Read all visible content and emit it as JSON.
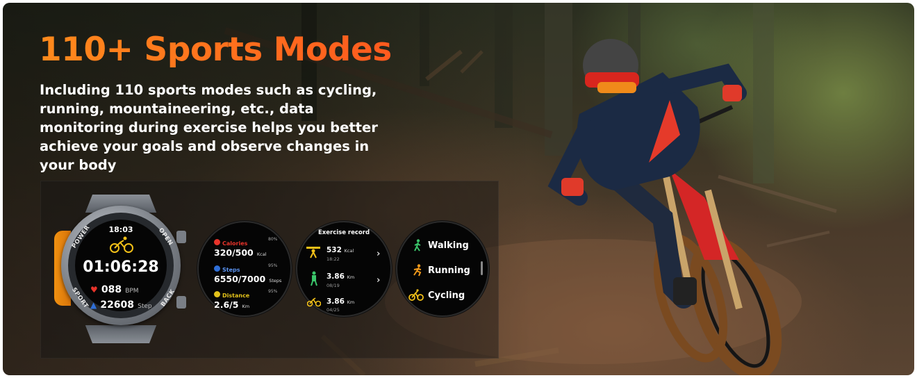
{
  "colors": {
    "accent_start": "#ff8a1c",
    "accent_end": "#ff5a1e",
    "calories": "#e8332a",
    "steps": "#2f6fd8",
    "distance": "#e3c21a",
    "walking": "#3ac46a",
    "running": "#f39a1a",
    "cycling": "#f2c018"
  },
  "headline": "110+ Sports Modes",
  "description": "Including 110 sports modes such as cycling, running, mountaineering, etc., data monitoring during exercise helps you better achieve your goals and observe changes in your body",
  "watch": {
    "time": "18:03",
    "workout_icon": "cycling-icon",
    "elapsed": "01:06:28",
    "heart_rate": "088",
    "heart_unit": "BPM",
    "steps": "22608",
    "steps_unit": "Step",
    "bezel_labels": {
      "top_left": "POWER",
      "top_right": "OPEN",
      "bottom_left": "SPORT",
      "bottom_right": "BACK"
    }
  },
  "stats_screen": {
    "items": [
      {
        "label": "Calories",
        "percent": "80%",
        "value": "320/500",
        "unit": "Kcal",
        "icon": "flame-icon"
      },
      {
        "label": "Steps",
        "percent": "95%",
        "value": "6550/7000",
        "unit": "Steps",
        "icon": "steps-icon"
      },
      {
        "label": "Distance",
        "percent": "95%",
        "value": "2.6/5",
        "unit": "Km",
        "icon": "location-pin-icon"
      }
    ]
  },
  "exercise_screen": {
    "title": "Exercise record",
    "records": [
      {
        "value": "532",
        "unit": "Kcal",
        "date": "18:22",
        "icon": "weightlifting-icon"
      },
      {
        "value": "3.86",
        "unit": "Km",
        "date": "08/19",
        "icon": "hiking-icon"
      },
      {
        "value": "3.86",
        "unit": "Km",
        "date": "04/25",
        "icon": "cycling-icon"
      }
    ]
  },
  "modes_screen": {
    "modes": [
      {
        "label": "Walking",
        "icon": "walking-icon"
      },
      {
        "label": "Running",
        "icon": "running-icon"
      },
      {
        "label": "Cycling",
        "icon": "cycling-icon"
      }
    ]
  }
}
